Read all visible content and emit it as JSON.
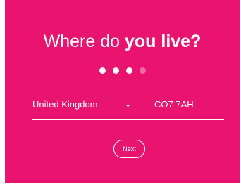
{
  "colors": {
    "panel_background": "#e9146f",
    "text": "#ffffff",
    "dot_completed": "#ffffff",
    "dot_remaining": "#f26aa4",
    "page_background": "#ffffff"
  },
  "heading": {
    "regular": "Where do ",
    "bold": "you live?"
  },
  "progress": {
    "total_steps": 4,
    "current_step": 3
  },
  "address": {
    "country_value": "United Kingdom",
    "country_icon": "chevron-down-icon",
    "chevron_glyph": "⌄",
    "postcode_value": "CO7 7AH"
  },
  "actions": {
    "next_label": "Next"
  }
}
